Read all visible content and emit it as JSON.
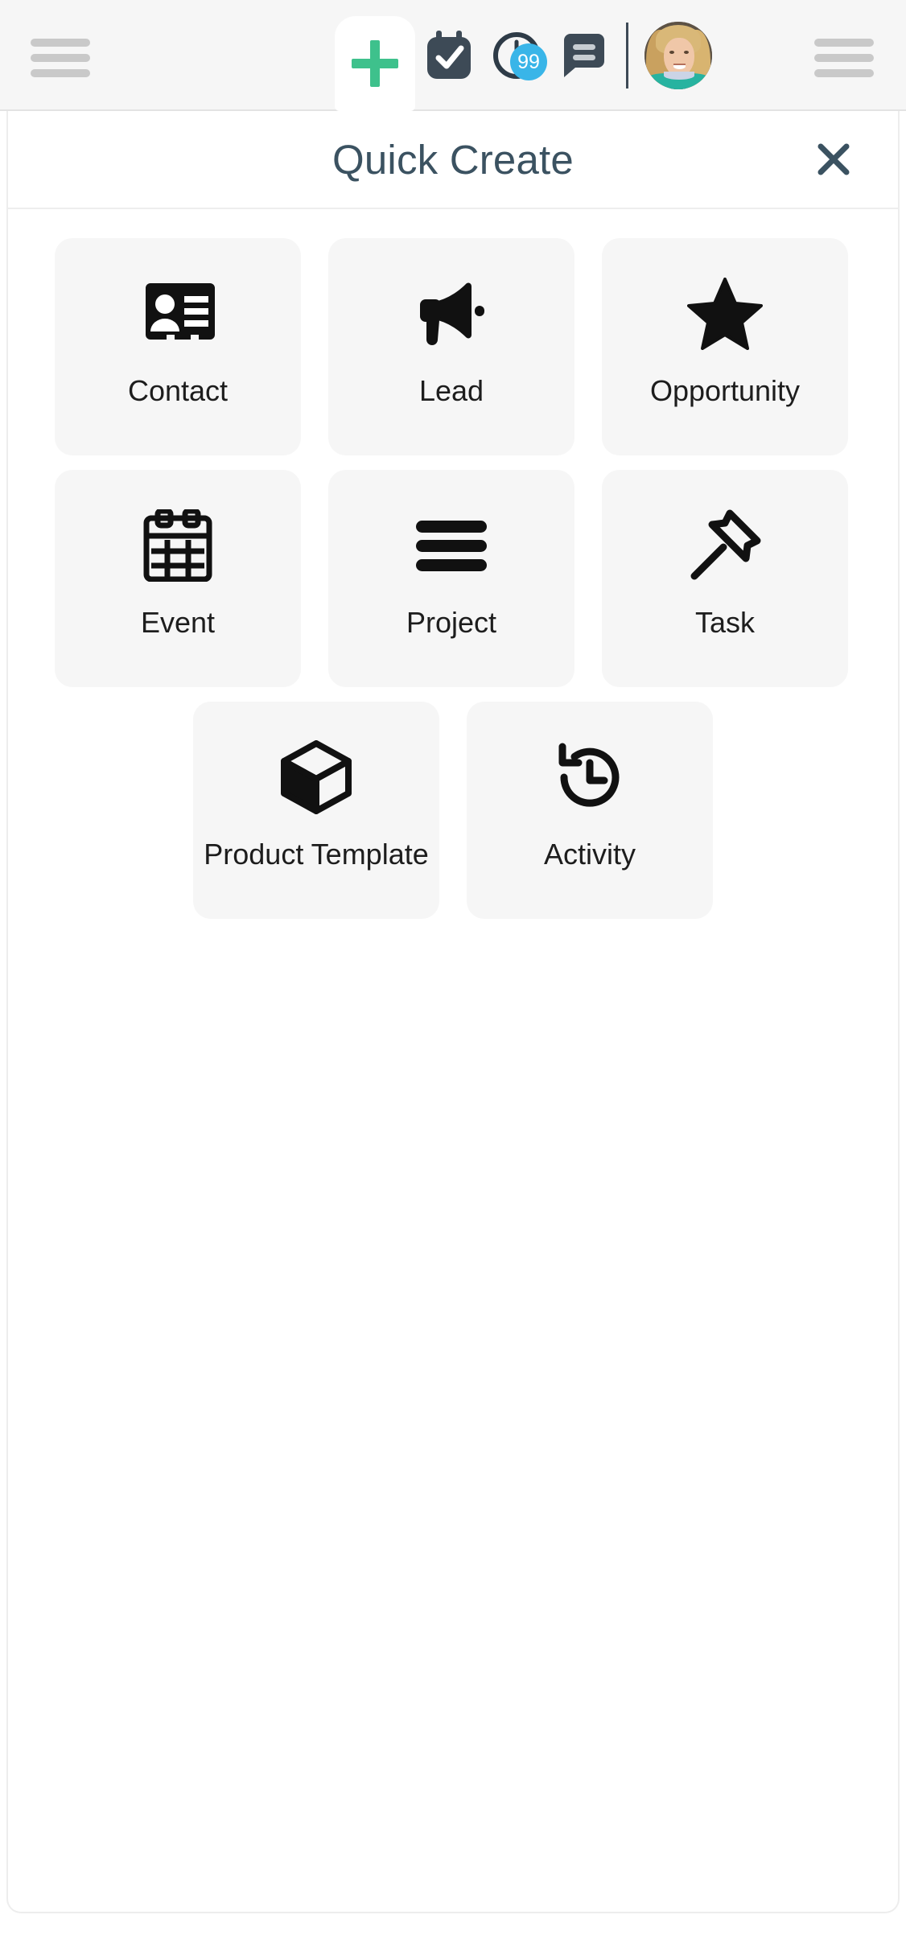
{
  "topbar": {
    "left_menu_label": "Main menu",
    "right_menu_label": "More options",
    "create_tab_label": "Create",
    "calendar_label": "Calendar",
    "clock_label": "Timer",
    "clock_badge": "99",
    "chat_label": "Chat",
    "avatar_label": "User profile",
    "accent_green": "#3ec18c",
    "badge_blue": "#39b5e8",
    "icon_navy": "#3d4a56"
  },
  "panel": {
    "title": "Quick Create",
    "close_label": "Close",
    "title_color": "#3b5261"
  },
  "tiles": {
    "rows": [
      [
        {
          "label": "Contact",
          "icon": "contact-card-icon"
        },
        {
          "label": "Lead",
          "icon": "megaphone-icon"
        },
        {
          "label": "Opportunity",
          "icon": "star-icon"
        }
      ],
      [
        {
          "label": "Event",
          "icon": "calendar-grid-icon"
        },
        {
          "label": "Project",
          "icon": "bars-icon"
        },
        {
          "label": "Task",
          "icon": "pushpin-icon"
        }
      ],
      [
        {
          "label": "Product\nTemplate",
          "icon": "cube-icon"
        },
        {
          "label": "Activity",
          "icon": "history-clock-icon"
        }
      ]
    ],
    "background": "#f6f6f6",
    "icon_color": "#111111"
  }
}
